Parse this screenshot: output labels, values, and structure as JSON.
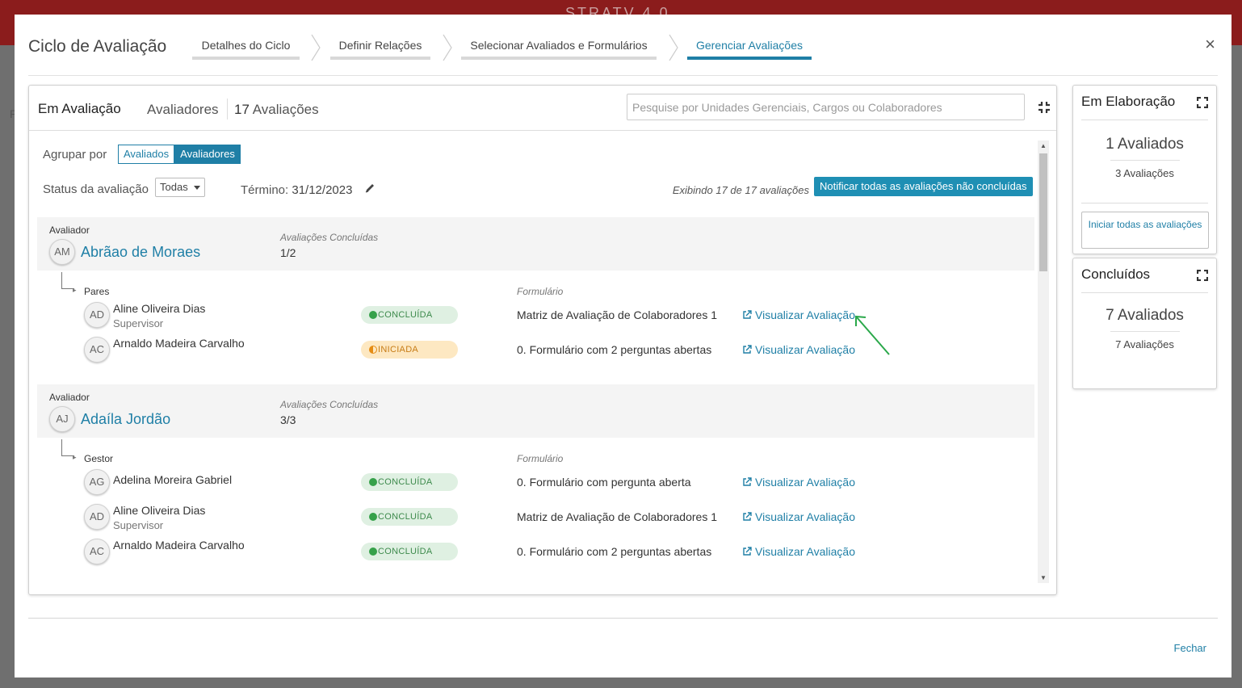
{
  "app": {
    "topbar_brand": "STRATV 4.0",
    "bg_letter": "P"
  },
  "modal": {
    "title": "Ciclo de Avaliação",
    "close_label": "×",
    "steps": [
      {
        "label": "Detalhes do Ciclo",
        "active": false
      },
      {
        "label": "Definir Relações",
        "active": false
      },
      {
        "label": "Selecionar Avaliados e Formulários",
        "active": false
      },
      {
        "label": "Gerenciar Avaliações",
        "active": true
      }
    ],
    "footer_close": "Fechar"
  },
  "main": {
    "tab_active": "Em Avaliação",
    "tab_avaliadores": "Avaliadores",
    "tab_count_number": "17",
    "tab_count_label": "Avaliações",
    "search_placeholder": "Pesquise por Unidades Gerenciais, Cargos ou Colaboradores",
    "group_by_label": "Agrupar por",
    "group_by_options": [
      "Avaliados",
      "Avaliadores"
    ],
    "group_by_selected": "Avaliadores",
    "status_label": "Status da avaliação",
    "status_value": "Todas",
    "termino_label": "Término:",
    "termino_value": "31/12/2023",
    "exibindo": "Exibindo 17 de 17 avaliações",
    "notify_button": "Notificar todas as avaliações não concluídas",
    "groups": [
      {
        "label": "Avaliador",
        "initials": "AM",
        "name": "Abrãao de Moraes",
        "concluded_label": "Avaliações Concluídas",
        "concluded_value": "1/2",
        "relation": "Pares",
        "form_label": "Formulário",
        "rows": [
          {
            "initials": "AD",
            "name": "Aline Oliveira Dias",
            "role": "Supervisor",
            "status": "CONCLUÍDA",
            "form": "Matriz de Avaliação de Colaboradores 1",
            "link": "Visualizar Avaliação"
          },
          {
            "initials": "AC",
            "name": "Arnaldo Madeira Carvalho",
            "role": "",
            "status": "INICIADA",
            "form": "0. Formulário com 2 perguntas abertas",
            "link": "Visualizar Avaliação"
          }
        ]
      },
      {
        "label": "Avaliador",
        "initials": "AJ",
        "name": "Adaíla Jordão",
        "concluded_label": "Avaliações Concluídas",
        "concluded_value": "3/3",
        "relation": "Gestor",
        "form_label": "Formulário",
        "rows": [
          {
            "initials": "AG",
            "name": "Adelina Moreira Gabriel",
            "role": "",
            "status": "CONCLUÍDA",
            "form": "0. Formulário com pergunta aberta",
            "link": "Visualizar Avaliação"
          },
          {
            "initials": "AD",
            "name": "Aline Oliveira Dias",
            "role": "Supervisor",
            "status": "CONCLUÍDA",
            "form": "Matriz de Avaliação de Colaboradores 1",
            "link": "Visualizar Avaliação"
          },
          {
            "initials": "AC",
            "name": "Arnaldo Madeira Carvalho",
            "role": "",
            "status": "CONCLUÍDA",
            "form": "0. Formulário com 2 perguntas abertas",
            "link": "Visualizar Avaliação"
          }
        ]
      }
    ]
  },
  "side_panels": [
    {
      "title": "Em Elaboração",
      "avaliados": "1 Avaliados",
      "avaliacoes": "3 Avaliações",
      "button": "Iniciar todas as avaliações"
    },
    {
      "title": "Concluídos",
      "avaliados": "7 Avaliados",
      "avaliacoes": "7 Avaliações"
    }
  ],
  "colors": {
    "accent": "#1f7fa6",
    "brand": "#8b1c1c",
    "done": "#36a14a",
    "started": "#e58c14",
    "annotation_arrow": "#2aa84a"
  },
  "icons": [
    "close-icon",
    "collapse-icon",
    "pencil-icon",
    "external-link-icon",
    "expand-icon",
    "caret-down-icon"
  ]
}
